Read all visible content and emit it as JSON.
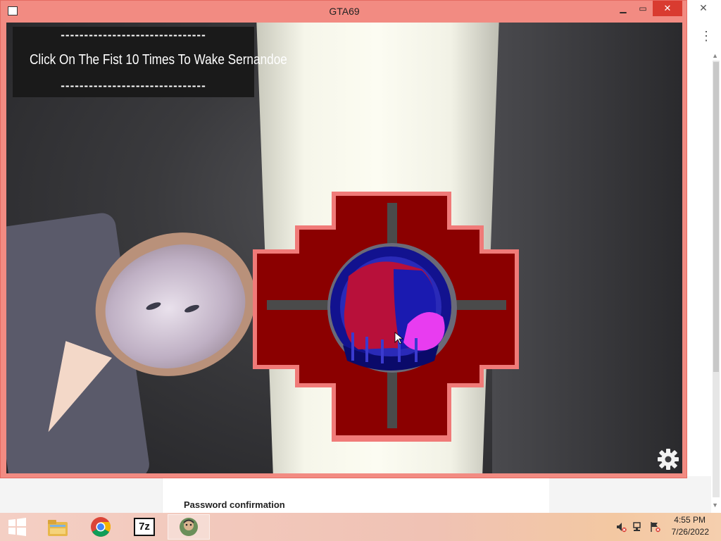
{
  "window": {
    "title": "GTA69"
  },
  "banner": {
    "dashes_top": "-------------------------------",
    "instruction": "Click On The Fist 10 Times To Wake Sernandoe",
    "dashes_bottom": "-------------------------------"
  },
  "background_window": {
    "password_label": "Password confirmation"
  },
  "taskbar": {
    "apps": [
      "start-icon",
      "file-explorer-icon",
      "chrome-icon",
      "7zip-icon",
      "game-app-icon"
    ],
    "sevenzip_label": "7z",
    "clock_time": "4:55 PM",
    "clock_date": "7/26/2022"
  },
  "colors": {
    "window_border": "#f28b82",
    "close_button": "#d93b30",
    "cross_red": "#8b0000",
    "cross_outline": "#f07a78",
    "fist_circle": "#1a1aa0",
    "fist_magenta": "#e83cf0"
  }
}
